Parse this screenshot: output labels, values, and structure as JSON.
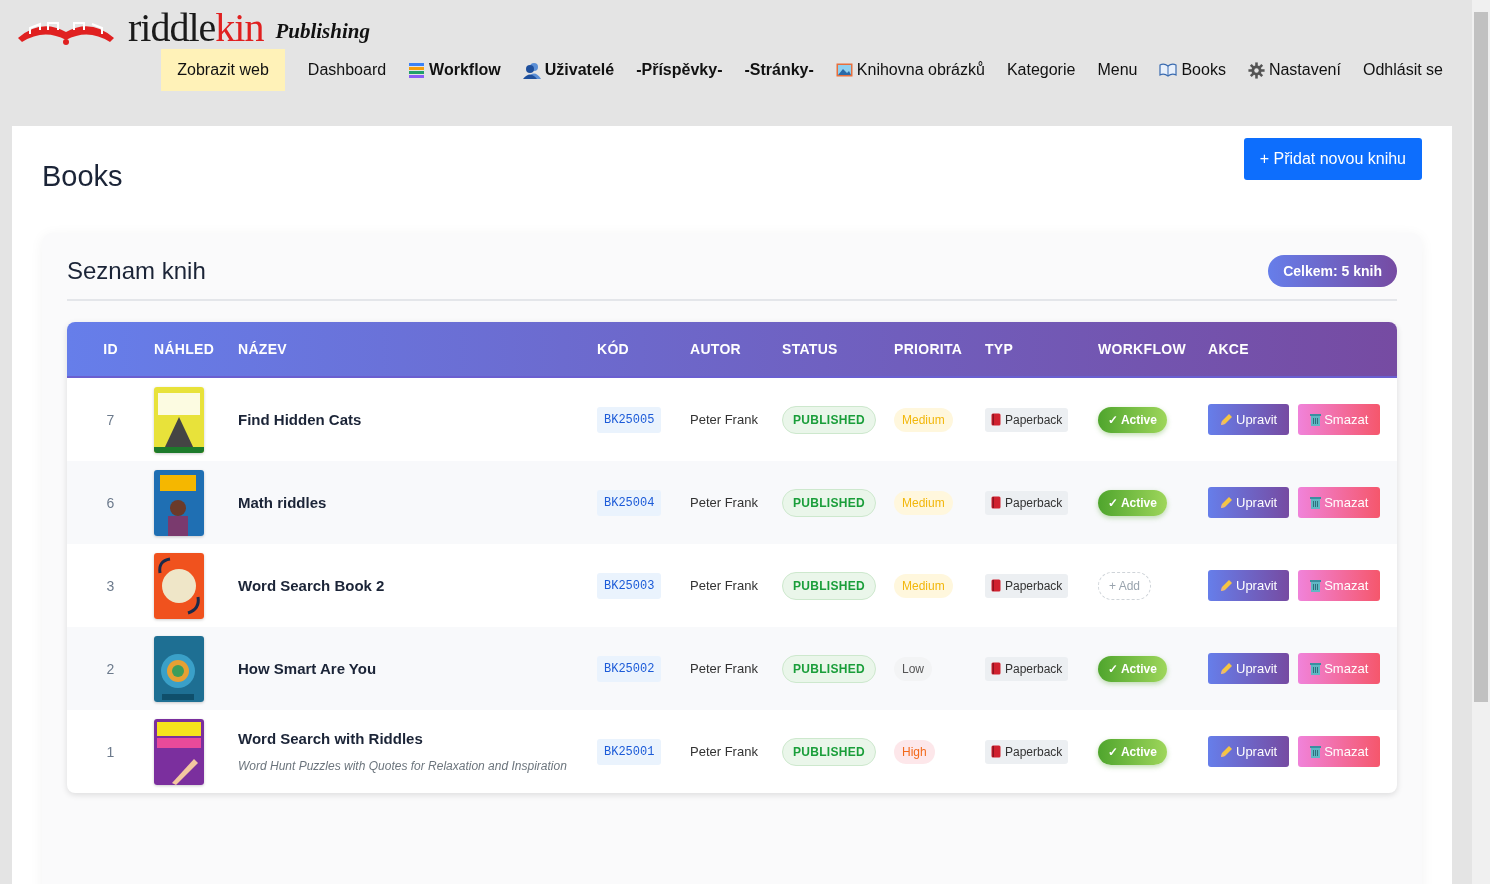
{
  "brand": {
    "name_dark": "riddle",
    "name_red": "kin",
    "tagline": "Publishing"
  },
  "nav": [
    {
      "label": "Zobrazit web",
      "selected": true,
      "emphasized": false
    },
    {
      "label": "Dashboard",
      "selected": false,
      "emphasized": false
    },
    {
      "label": "Workflow",
      "selected": false,
      "emphasized": true
    },
    {
      "label": "Uživatelé",
      "selected": false,
      "emphasized": true
    },
    {
      "label": "-Příspěvky-",
      "selected": false,
      "emphasized": true
    },
    {
      "label": "-Stránky-",
      "selected": false,
      "emphasized": true
    },
    {
      "label": "Knihovna obrázků",
      "selected": false,
      "emphasized": false
    },
    {
      "label": "Kategorie",
      "selected": false,
      "emphasized": false
    },
    {
      "label": "Menu",
      "selected": false,
      "emphasized": false
    },
    {
      "label": "Books",
      "selected": false,
      "emphasized": false
    },
    {
      "label": "Nastavení",
      "selected": false,
      "emphasized": false
    },
    {
      "label": "Odhlásit se",
      "selected": false,
      "emphasized": false
    }
  ],
  "page": {
    "title": "Books",
    "add_button": "+ Přidat novou knihu"
  },
  "list": {
    "title": "Seznam knih",
    "total_badge": "Celkem: 5 knih",
    "columns": [
      "ID",
      "NÁHLED",
      "NÁZEV",
      "KÓD",
      "AUTOR",
      "STATUS",
      "PRIORITA",
      "TYP",
      "WORKFLOW",
      "AKCE"
    ],
    "rows": [
      {
        "id": "7",
        "title": "Find Hidden Cats",
        "code": "BK25005",
        "author": "Peter Frank",
        "status": "PUBLISHED",
        "priority": {
          "label": "Medium",
          "kind": "medium"
        },
        "type": "Paperback",
        "workflow": {
          "kind": "active",
          "label": "✓ Active"
        },
        "edit": "Upravit",
        "delete": "Smazat"
      },
      {
        "id": "6",
        "title": "Math riddles",
        "code": "BK25004",
        "author": "Peter Frank",
        "status": "PUBLISHED",
        "priority": {
          "label": "Medium",
          "kind": "medium"
        },
        "type": "Paperback",
        "workflow": {
          "kind": "active",
          "label": "✓ Active"
        },
        "edit": "Upravit",
        "delete": "Smazat"
      },
      {
        "id": "3",
        "title": "Word Search Book 2",
        "code": "BK25003",
        "author": "Peter Frank",
        "status": "PUBLISHED",
        "priority": {
          "label": "Medium",
          "kind": "medium"
        },
        "type": "Paperback",
        "workflow": {
          "kind": "add",
          "label": "+ Add"
        },
        "edit": "Upravit",
        "delete": "Smazat"
      },
      {
        "id": "2",
        "title": "How Smart Are You",
        "code": "BK25002",
        "author": "Peter Frank",
        "status": "PUBLISHED",
        "priority": {
          "label": "Low",
          "kind": "low"
        },
        "type": "Paperback",
        "workflow": {
          "kind": "active",
          "label": "✓ Active"
        },
        "edit": "Upravit",
        "delete": "Smazat"
      },
      {
        "id": "1",
        "title": "Word Search with Riddles",
        "subtitle": "Word Hunt Puzzles with Quotes for Relaxation and Inspiration",
        "code": "BK25001",
        "author": "Peter Frank",
        "status": "PUBLISHED",
        "priority": {
          "label": "High",
          "kind": "high"
        },
        "type": "Paperback",
        "workflow": {
          "kind": "active",
          "label": "✓ Active"
        },
        "edit": "Upravit",
        "delete": "Smazat"
      }
    ]
  }
}
